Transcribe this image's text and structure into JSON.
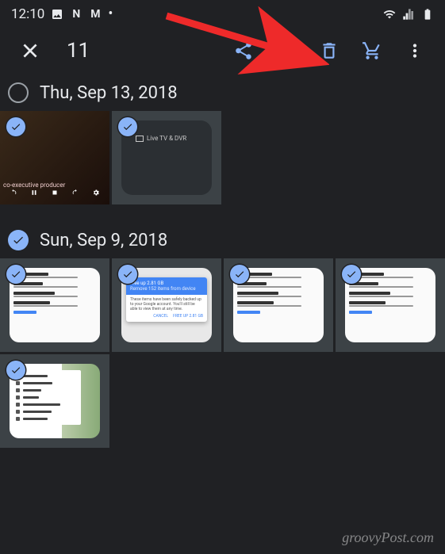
{
  "statusbar": {
    "time": "12:10",
    "left_icons": [
      "image-icon",
      "netflix-icon",
      "gmail-icon",
      "dot-icon"
    ],
    "right_icons": [
      "wifi-icon",
      "signal-icon",
      "battery-icon"
    ]
  },
  "appbar": {
    "selected_count": "11"
  },
  "sections": [
    {
      "fully_selected": false,
      "date": "Thu, Sep 13, 2018",
      "items": [
        {
          "type": "video",
          "selected": true,
          "caption": "co-executive producer"
        },
        {
          "type": "livetv",
          "selected": true,
          "label": "Live TV & DVR"
        }
      ]
    },
    {
      "fully_selected": true,
      "date": "Sun, Sep 9, 2018",
      "items": [
        {
          "type": "settings",
          "selected": true,
          "rows": [
            "Device storage",
            "Notifications",
            "Group similar faces",
            "Assistant cards",
            "Shared libraries"
          ]
        },
        {
          "type": "dialog",
          "selected": true,
          "dialog_title": "Free up 2.81 GB",
          "dialog_sub": "Remove 152 items from device",
          "dialog_body": "These items have been safely backed up to your Google account. You'll still be able to view them at any time.",
          "dialog_actions": [
            "CANCEL",
            "FREE UP 2.81 GB"
          ]
        },
        {
          "type": "settings",
          "selected": true,
          "rows": [
            "Device storage",
            "Notifications",
            "Group similar faces",
            "Assistant cards",
            "Shared libraries"
          ]
        },
        {
          "type": "settings",
          "selected": true,
          "rows": [
            "Device storage",
            "Notifications",
            "Group similar faces",
            "Assistant cards",
            "Shared libraries"
          ]
        },
        {
          "type": "menu",
          "selected": true,
          "menu_items": [
            "Photo frames",
            "Device folders",
            "Archive",
            "Trash",
            "Add partner account",
            "Free up space",
            "Scan photos"
          ]
        }
      ]
    }
  ],
  "watermark": "groovyPost.com"
}
